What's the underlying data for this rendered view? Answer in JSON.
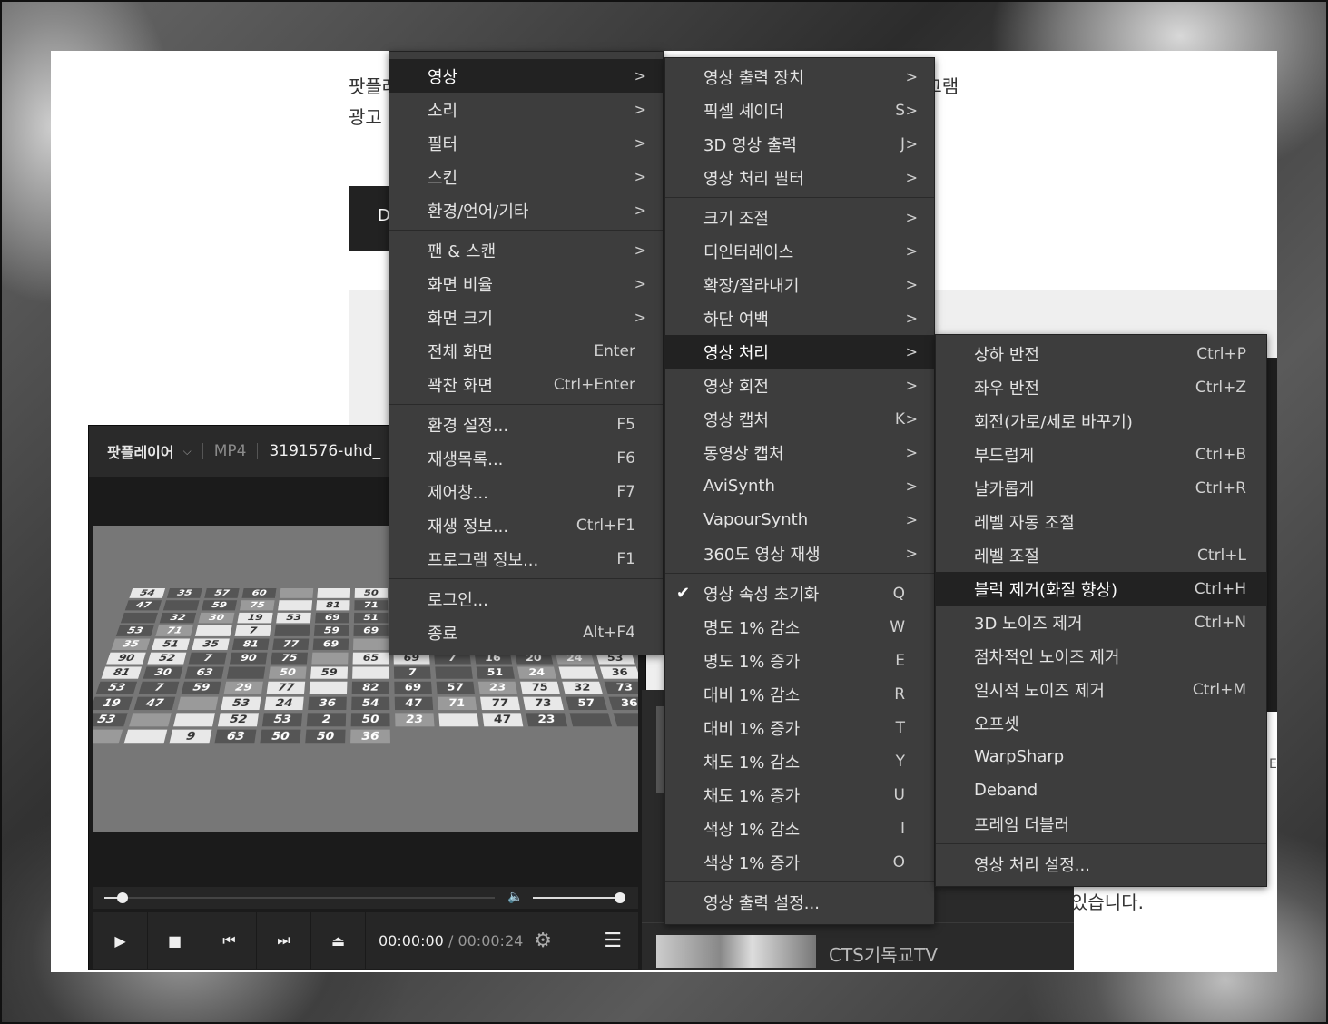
{
  "webpage": {
    "text_line1": "팟플레이어는 방송법 시행령 제59조의 5에서 정한 ‘영리 목적의 광고성 프로그램",
    "text_line2": "광고",
    "button_label": "D",
    "ending_text": "있습니다.",
    "side_char": "E"
  },
  "player": {
    "brand": "팟플레이어",
    "format": "MP4",
    "filename": "3191576-uhd_",
    "time_current": "00:00:00",
    "time_separator": "/",
    "time_total": "00:00:24",
    "channel_name": "CTS기독교TV",
    "video_numbers": [
      "54",
      "35",
      "57",
      "60",
      "",
      "",
      "50",
      "36",
      "",
      "24",
      "6",
      "16",
      "16",
      "47",
      "",
      "59",
      "75",
      "",
      "81",
      "71",
      "57",
      "30",
      "50",
      "",
      "57",
      "60",
      "",
      "32",
      "30",
      "19",
      "53",
      "69",
      "51",
      "90",
      "",
      "90",
      "47",
      "12",
      "2",
      "53",
      "71",
      "",
      "7",
      "",
      "59",
      "69",
      "46",
      "75",
      "24",
      "82",
      "23",
      "29",
      "35",
      "51",
      "35",
      "81",
      "77",
      "69",
      "",
      "90",
      "",
      "21",
      "90",
      "",
      "81",
      "90",
      "52",
      "7",
      "90",
      "75",
      "",
      "65",
      "69",
      "7",
      "16",
      "20",
      "24",
      "53",
      "81",
      "30",
      "63",
      "",
      "50",
      "59",
      "",
      "7",
      "",
      "51",
      "24",
      "",
      "36",
      "53",
      "7",
      "59",
      "29",
      "77",
      "",
      "82",
      "69",
      "57",
      "23",
      "75",
      "32",
      "73",
      "19",
      "47",
      "",
      "53",
      "24",
      "36",
      "54",
      "47",
      "71",
      "77",
      "73",
      "57",
      "36",
      "53",
      "",
      "",
      "52",
      "53",
      "2",
      "50",
      "23",
      "",
      "47",
      "23",
      "",
      "",
      "",
      "",
      "9",
      "63",
      "50",
      "50",
      "36"
    ]
  },
  "menu_main": {
    "items": [
      {
        "label": "영상",
        "arrow": ">"
      },
      {
        "label": "소리",
        "arrow": ">"
      },
      {
        "label": "필터",
        "arrow": ">"
      },
      {
        "label": "스킨",
        "arrow": ">"
      },
      {
        "label": "환경/언어/기타",
        "arrow": ">"
      },
      {
        "label": "팬 & 스캔",
        "arrow": ">"
      },
      {
        "label": "화면 비율",
        "arrow": ">"
      },
      {
        "label": "화면 크기",
        "arrow": ">"
      },
      {
        "label": "전체 화면",
        "shortcut": "Enter"
      },
      {
        "label": "꽉찬 화면",
        "shortcut": "Ctrl+Enter"
      },
      {
        "label": "환경 설정...",
        "shortcut": "F5"
      },
      {
        "label": "재생목록...",
        "shortcut": "F6"
      },
      {
        "label": "제어창...",
        "shortcut": "F7"
      },
      {
        "label": "재생 정보...",
        "shortcut": "Ctrl+F1"
      },
      {
        "label": "프로그램 정보...",
        "shortcut": "F1"
      },
      {
        "label": "로그인..."
      },
      {
        "label": "종료",
        "shortcut": "Alt+F4"
      }
    ]
  },
  "menu_video": {
    "items": [
      {
        "label": "영상 출력 장치",
        "arrow": ">"
      },
      {
        "label": "픽셀 셰이더",
        "shortcut": "S",
        "arrow": ">"
      },
      {
        "label": "3D 영상 출력",
        "shortcut": "J",
        "arrow": ">"
      },
      {
        "label": "영상 처리 필터",
        "arrow": ">"
      },
      {
        "label": "크기 조절",
        "arrow": ">"
      },
      {
        "label": "디인터레이스",
        "arrow": ">"
      },
      {
        "label": "확장/잘라내기",
        "arrow": ">"
      },
      {
        "label": "하단 여백",
        "arrow": ">"
      },
      {
        "label": "영상 처리",
        "arrow": ">"
      },
      {
        "label": "영상 회전",
        "arrow": ">"
      },
      {
        "label": "영상 캡처",
        "shortcut": "K",
        "arrow": ">"
      },
      {
        "label": "동영상 캡처",
        "arrow": ">"
      },
      {
        "label": "AviSynth",
        "arrow": ">"
      },
      {
        "label": "VapourSynth",
        "arrow": ">"
      },
      {
        "label": "360도 영상 재생",
        "arrow": ">"
      },
      {
        "label": "영상 속성 초기화",
        "shortcut": "Q",
        "check": "✔"
      },
      {
        "label": "명도 1% 감소",
        "shortcut": "W"
      },
      {
        "label": "명도 1% 증가",
        "shortcut": "E"
      },
      {
        "label": "대비 1% 감소",
        "shortcut": "R"
      },
      {
        "label": "대비 1% 증가",
        "shortcut": "T"
      },
      {
        "label": "채도 1% 감소",
        "shortcut": "Y"
      },
      {
        "label": "채도 1% 증가",
        "shortcut": "U"
      },
      {
        "label": "색상 1% 감소",
        "shortcut": "I"
      },
      {
        "label": "색상 1% 증가",
        "shortcut": "O"
      },
      {
        "label": "영상 출력 설정..."
      }
    ]
  },
  "menu_processing": {
    "items": [
      {
        "label": "상하 반전",
        "shortcut": "Ctrl+P"
      },
      {
        "label": "좌우 반전",
        "shortcut": "Ctrl+Z"
      },
      {
        "label": "회전(가로/세로 바꾸기)"
      },
      {
        "label": "부드럽게",
        "shortcut": "Ctrl+B"
      },
      {
        "label": "날카롭게",
        "shortcut": "Ctrl+R"
      },
      {
        "label": "레벨 자동 조절"
      },
      {
        "label": "레벨 조절",
        "shortcut": "Ctrl+L"
      },
      {
        "label": "블럭 제거(화질 향상)",
        "shortcut": "Ctrl+H"
      },
      {
        "label": "3D 노이즈 제거",
        "shortcut": "Ctrl+N"
      },
      {
        "label": "점차적인 노이즈 제거"
      },
      {
        "label": "일시적 노이즈 제거",
        "shortcut": "Ctrl+M"
      },
      {
        "label": "오프셋"
      },
      {
        "label": "WarpSharp"
      },
      {
        "label": "Deband"
      },
      {
        "label": "프레임 더블러"
      },
      {
        "label": "영상 처리 설정..."
      }
    ]
  }
}
